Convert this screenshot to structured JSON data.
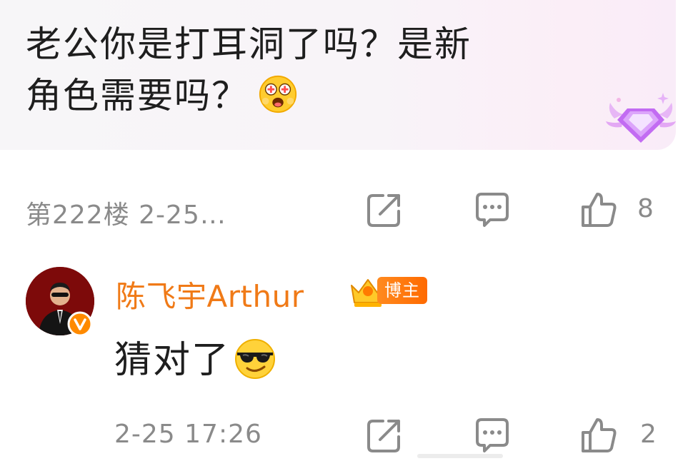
{
  "post": {
    "text_line1": "老公你是打耳洞了吗？是新",
    "text_line2": "角色需要吗？",
    "emoji": "star-eyes-emoji"
  },
  "post_meta": {
    "floor_and_time": "第222楼 2-25…",
    "like_count": "8"
  },
  "reply": {
    "author_name": "陈飞宇Arthur",
    "author_tag": "博主",
    "text": "猜对了",
    "emoji": "sunglasses-emoji",
    "timestamp": "2-25 17:26",
    "like_count": "2"
  },
  "colors": {
    "card_bg": "#f7f6f8",
    "author_orange": "#f07a17",
    "meta_gray": "#8a8a8a",
    "tag_orange": "#ff7a10",
    "gem_purple": "#c26cf2"
  }
}
